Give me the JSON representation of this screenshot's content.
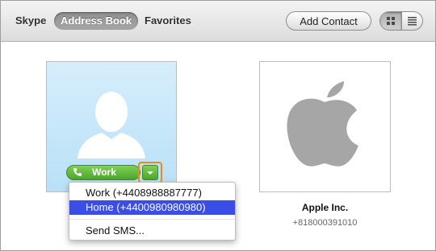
{
  "toolbar": {
    "tabs": [
      {
        "label": "Skype"
      },
      {
        "label": "Address Book"
      },
      {
        "label": "Favorites"
      }
    ],
    "add_contact_label": "Add Contact",
    "view_modes": [
      "grid-view-icon",
      "list-view-icon"
    ]
  },
  "contacts": [
    {
      "avatar": "person-silhouette-icon",
      "call_button_label": "Work",
      "menu": {
        "items": [
          {
            "label": "Work (+4408988887777)"
          },
          {
            "label": "Home (+4400980980980)"
          },
          {
            "label": "Send SMS..."
          }
        ]
      }
    },
    {
      "avatar": "apple-logo-icon",
      "name": "Apple Inc.",
      "phone": "+818000391010"
    }
  ],
  "colors": {
    "menu_highlight": "#3a4de7",
    "call_green": "#5cb536",
    "focus_orange": "#f08a16",
    "avatar_blue": "#c6e6fa"
  }
}
